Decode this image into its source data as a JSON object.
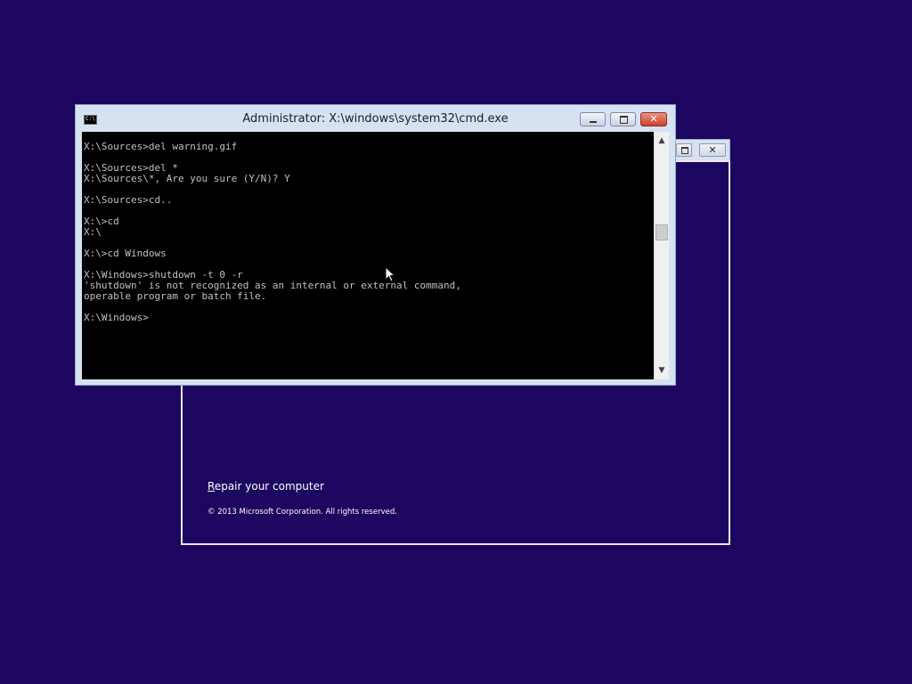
{
  "setup_window": {
    "repair_link_underlined": "R",
    "repair_link_rest": "epair your computer",
    "copyright": "© 2013 Microsoft Corporation. All rights reserved.",
    "close_glyph": "✕"
  },
  "cmd_window": {
    "title": "Administrator: X:\\windows\\system32\\cmd.exe",
    "icon_text": "C:\\",
    "close_glyph": "✕",
    "console_lines": [
      "X:\\Sources>del warning.gif",
      "",
      "X:\\Sources>del *",
      "X:\\Sources\\*, Are you sure (Y/N)? Y",
      "",
      "X:\\Sources>cd..",
      "",
      "X:\\>cd",
      "X:\\",
      "",
      "X:\\>cd Windows",
      "",
      "X:\\Windows>shutdown -t 0 -r",
      "'shutdown' is not recognized as an internal or external command,",
      "operable program or batch file.",
      "",
      "X:\\Windows>"
    ],
    "scroll_up_glyph": "▲",
    "scroll_down_glyph": "▼"
  },
  "colors": {
    "desktop_bg": "#1c0660",
    "console_bg": "#000000",
    "console_fg": "#c0c0c0",
    "titlebar": "#d6e2f2",
    "close_button": "#c9412a"
  }
}
